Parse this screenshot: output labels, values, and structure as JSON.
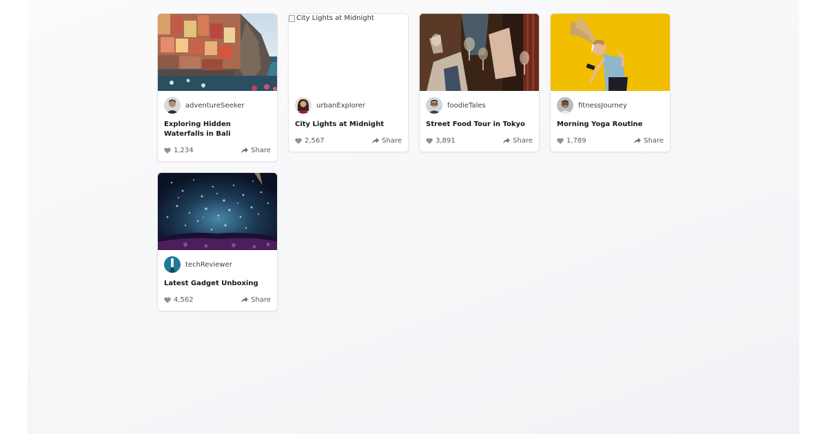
{
  "posts": [
    {
      "username": "adventureSeeker",
      "title": "Exploring Hidden Waterfalls in Bali",
      "likes": "1,234",
      "share_label": "Share",
      "image_icon": "coastal-village-photo",
      "avatar_icon": "man-portrait-avatar"
    },
    {
      "username": "urbanExplorer",
      "title": "City Lights at Midnight",
      "likes": "2,567",
      "share_label": "Share",
      "image_alt": "City Lights at Midnight",
      "image_icon": "broken-image-icon",
      "avatar_icon": "woman-portrait-avatar"
    },
    {
      "username": "foodieTales",
      "title": "Street Food Tour in Tokyo",
      "likes": "3,891",
      "share_label": "Share",
      "image_icon": "wine-toast-photo",
      "avatar_icon": "man-glasses-avatar"
    },
    {
      "username": "fitnessJourney",
      "title": "Morning Yoga Routine",
      "likes": "1,789",
      "share_label": "Share",
      "image_icon": "woman-music-photo",
      "avatar_icon": "man-smiling-avatar"
    },
    {
      "username": "techReviewer",
      "title": "Latest Gadget Unboxing",
      "likes": "4,562",
      "share_label": "Share",
      "image_icon": "concert-confetti-photo",
      "avatar_icon": "tech-avatar"
    }
  ]
}
